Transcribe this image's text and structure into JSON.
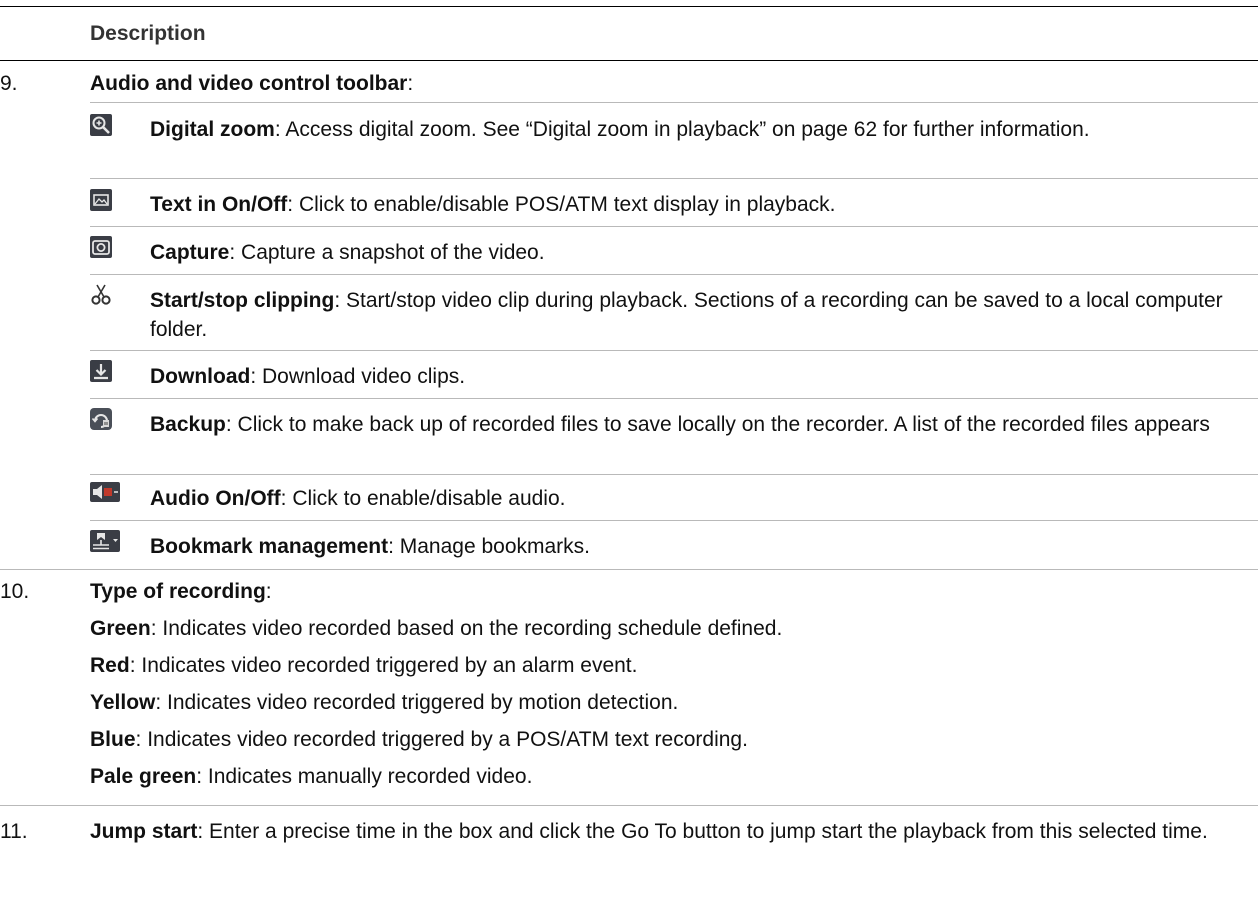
{
  "table": {
    "header": "Description",
    "item9": {
      "number": "9.",
      "title": "Audio and video control toolbar",
      "rows": [
        {
          "icon": "zoom-in-icon",
          "title": "Digital zoom",
          "text": "Access digital zoom. See “Digital zoom in playback” on page 62 for further information."
        },
        {
          "icon": "text-overlay-icon",
          "title": "Text in On/Off",
          "text": "Click to enable/disable POS/ATM text display in playback."
        },
        {
          "icon": "camera-icon",
          "title": "Capture",
          "text": "Capture a snapshot of the video."
        },
        {
          "icon": "scissors-icon",
          "title": "Start/stop clipping",
          "text": "Start/stop video clip during playback. Sections of a recording can be saved to a local computer folder."
        },
        {
          "icon": "download-icon",
          "title": "Download",
          "text": "Download video clips."
        },
        {
          "icon": "backup-icon",
          "title": "Backup",
          "text": "Click to make back up of recorded files to save locally on the recorder. A list of the recorded files appears"
        },
        {
          "icon": "audio-icon",
          "title": "Audio On/Off",
          "text": "Click to enable/disable audio."
        },
        {
          "icon": "bookmark-icon",
          "title": "Bookmark management",
          "text": "Manage bookmarks."
        }
      ]
    },
    "item10": {
      "number": "10.",
      "title": "Type of recording",
      "items": [
        {
          "label": "Green",
          "text": "Indicates video recorded based on the recording schedule defined."
        },
        {
          "label": "Red",
          "text": "Indicates video recorded triggered by an alarm event."
        },
        {
          "label": "Yellow",
          "text": "Indicates video recorded triggered by motion detection."
        },
        {
          "label": "Blue",
          "text": "Indicates video recorded triggered by a POS/ATM text recording."
        },
        {
          "label": "Pale green",
          "text": " Indicates manually recorded video."
        }
      ]
    },
    "item11": {
      "number": "11.",
      "title": "Jump start",
      "text": "Enter a precise time in the box and click the Go To button to jump start the playback from this selected time."
    }
  }
}
